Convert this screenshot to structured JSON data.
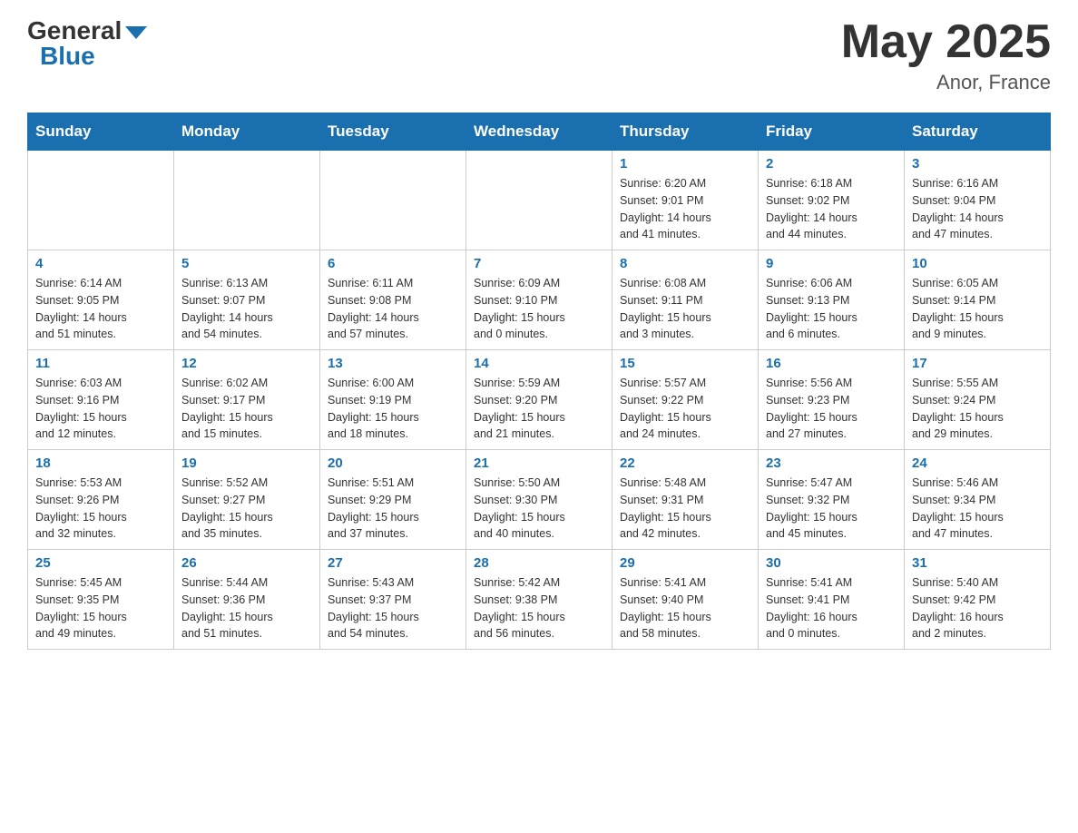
{
  "header": {
    "logo_general": "General",
    "logo_blue": "Blue",
    "month_title": "May 2025",
    "location": "Anor, France"
  },
  "weekdays": [
    "Sunday",
    "Monday",
    "Tuesday",
    "Wednesday",
    "Thursday",
    "Friday",
    "Saturday"
  ],
  "weeks": [
    [
      {
        "day": "",
        "info": ""
      },
      {
        "day": "",
        "info": ""
      },
      {
        "day": "",
        "info": ""
      },
      {
        "day": "",
        "info": ""
      },
      {
        "day": "1",
        "info": "Sunrise: 6:20 AM\nSunset: 9:01 PM\nDaylight: 14 hours\nand 41 minutes."
      },
      {
        "day": "2",
        "info": "Sunrise: 6:18 AM\nSunset: 9:02 PM\nDaylight: 14 hours\nand 44 minutes."
      },
      {
        "day": "3",
        "info": "Sunrise: 6:16 AM\nSunset: 9:04 PM\nDaylight: 14 hours\nand 47 minutes."
      }
    ],
    [
      {
        "day": "4",
        "info": "Sunrise: 6:14 AM\nSunset: 9:05 PM\nDaylight: 14 hours\nand 51 minutes."
      },
      {
        "day": "5",
        "info": "Sunrise: 6:13 AM\nSunset: 9:07 PM\nDaylight: 14 hours\nand 54 minutes."
      },
      {
        "day": "6",
        "info": "Sunrise: 6:11 AM\nSunset: 9:08 PM\nDaylight: 14 hours\nand 57 minutes."
      },
      {
        "day": "7",
        "info": "Sunrise: 6:09 AM\nSunset: 9:10 PM\nDaylight: 15 hours\nand 0 minutes."
      },
      {
        "day": "8",
        "info": "Sunrise: 6:08 AM\nSunset: 9:11 PM\nDaylight: 15 hours\nand 3 minutes."
      },
      {
        "day": "9",
        "info": "Sunrise: 6:06 AM\nSunset: 9:13 PM\nDaylight: 15 hours\nand 6 minutes."
      },
      {
        "day": "10",
        "info": "Sunrise: 6:05 AM\nSunset: 9:14 PM\nDaylight: 15 hours\nand 9 minutes."
      }
    ],
    [
      {
        "day": "11",
        "info": "Sunrise: 6:03 AM\nSunset: 9:16 PM\nDaylight: 15 hours\nand 12 minutes."
      },
      {
        "day": "12",
        "info": "Sunrise: 6:02 AM\nSunset: 9:17 PM\nDaylight: 15 hours\nand 15 minutes."
      },
      {
        "day": "13",
        "info": "Sunrise: 6:00 AM\nSunset: 9:19 PM\nDaylight: 15 hours\nand 18 minutes."
      },
      {
        "day": "14",
        "info": "Sunrise: 5:59 AM\nSunset: 9:20 PM\nDaylight: 15 hours\nand 21 minutes."
      },
      {
        "day": "15",
        "info": "Sunrise: 5:57 AM\nSunset: 9:22 PM\nDaylight: 15 hours\nand 24 minutes."
      },
      {
        "day": "16",
        "info": "Sunrise: 5:56 AM\nSunset: 9:23 PM\nDaylight: 15 hours\nand 27 minutes."
      },
      {
        "day": "17",
        "info": "Sunrise: 5:55 AM\nSunset: 9:24 PM\nDaylight: 15 hours\nand 29 minutes."
      }
    ],
    [
      {
        "day": "18",
        "info": "Sunrise: 5:53 AM\nSunset: 9:26 PM\nDaylight: 15 hours\nand 32 minutes."
      },
      {
        "day": "19",
        "info": "Sunrise: 5:52 AM\nSunset: 9:27 PM\nDaylight: 15 hours\nand 35 minutes."
      },
      {
        "day": "20",
        "info": "Sunrise: 5:51 AM\nSunset: 9:29 PM\nDaylight: 15 hours\nand 37 minutes."
      },
      {
        "day": "21",
        "info": "Sunrise: 5:50 AM\nSunset: 9:30 PM\nDaylight: 15 hours\nand 40 minutes."
      },
      {
        "day": "22",
        "info": "Sunrise: 5:48 AM\nSunset: 9:31 PM\nDaylight: 15 hours\nand 42 minutes."
      },
      {
        "day": "23",
        "info": "Sunrise: 5:47 AM\nSunset: 9:32 PM\nDaylight: 15 hours\nand 45 minutes."
      },
      {
        "day": "24",
        "info": "Sunrise: 5:46 AM\nSunset: 9:34 PM\nDaylight: 15 hours\nand 47 minutes."
      }
    ],
    [
      {
        "day": "25",
        "info": "Sunrise: 5:45 AM\nSunset: 9:35 PM\nDaylight: 15 hours\nand 49 minutes."
      },
      {
        "day": "26",
        "info": "Sunrise: 5:44 AM\nSunset: 9:36 PM\nDaylight: 15 hours\nand 51 minutes."
      },
      {
        "day": "27",
        "info": "Sunrise: 5:43 AM\nSunset: 9:37 PM\nDaylight: 15 hours\nand 54 minutes."
      },
      {
        "day": "28",
        "info": "Sunrise: 5:42 AM\nSunset: 9:38 PM\nDaylight: 15 hours\nand 56 minutes."
      },
      {
        "day": "29",
        "info": "Sunrise: 5:41 AM\nSunset: 9:40 PM\nDaylight: 15 hours\nand 58 minutes."
      },
      {
        "day": "30",
        "info": "Sunrise: 5:41 AM\nSunset: 9:41 PM\nDaylight: 16 hours\nand 0 minutes."
      },
      {
        "day": "31",
        "info": "Sunrise: 5:40 AM\nSunset: 9:42 PM\nDaylight: 16 hours\nand 2 minutes."
      }
    ]
  ]
}
